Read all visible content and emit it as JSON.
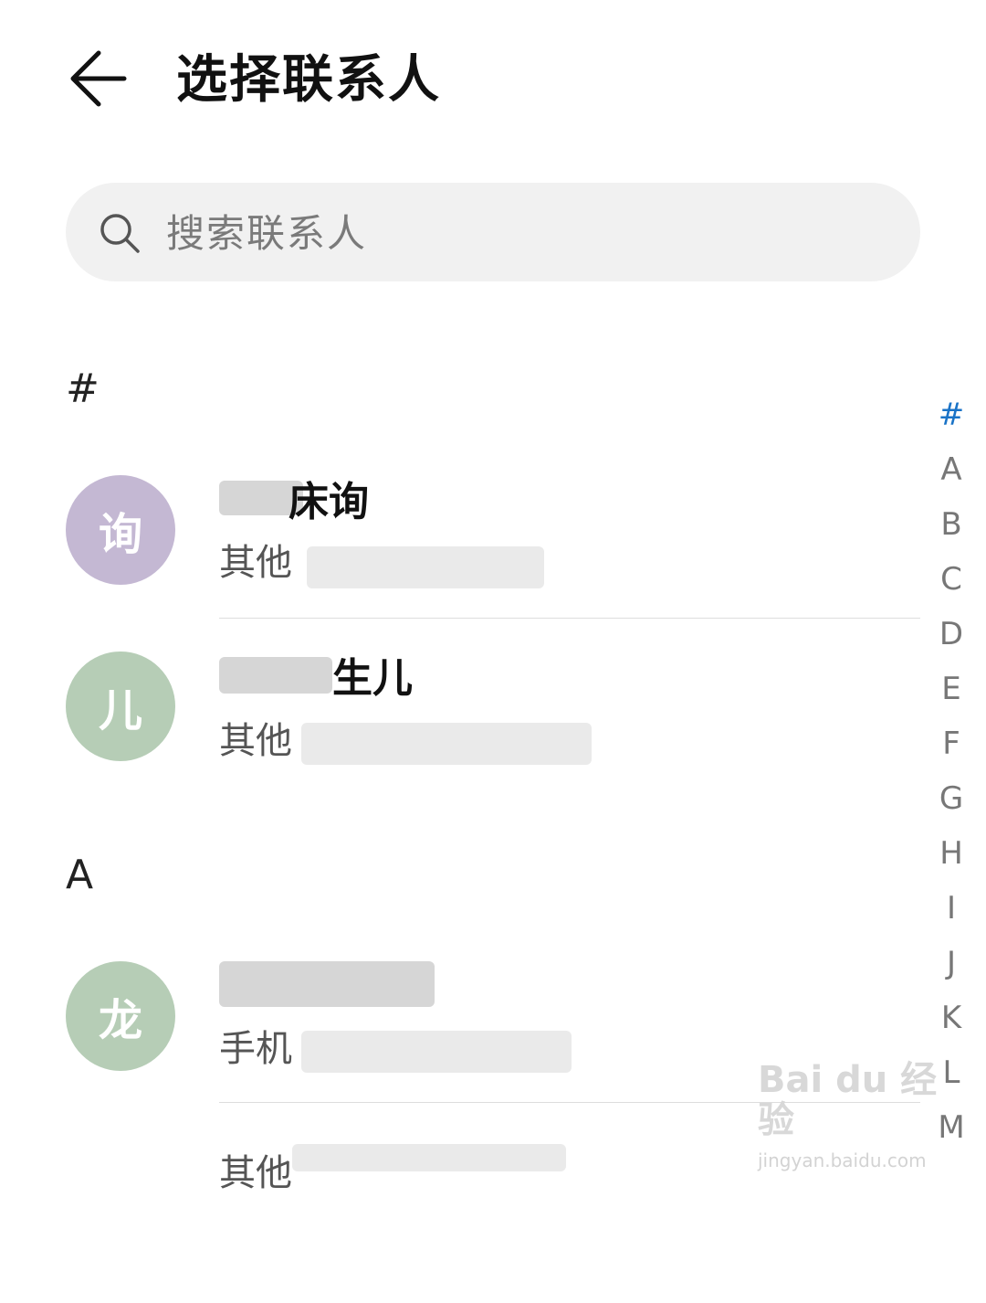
{
  "header": {
    "title": "选择联系人"
  },
  "search": {
    "placeholder": "搜索联系人"
  },
  "sections": [
    {
      "letter": "#",
      "contacts": [
        {
          "avatar_char": "询",
          "avatar_color": "#c4b8d3",
          "name_visible": "床询",
          "label": "其他"
        },
        {
          "avatar_char": "儿",
          "avatar_color": "#b6cdb6",
          "name_visible": "生儿",
          "label": "其他"
        }
      ]
    },
    {
      "letter": "A",
      "contacts": [
        {
          "avatar_char": "龙",
          "avatar_color": "#b6cdb6",
          "name_visible": "",
          "label": "手机"
        },
        {
          "avatar_char": "",
          "avatar_color": "",
          "name_visible": "",
          "label": "其他"
        }
      ]
    }
  ],
  "index_bar": {
    "letters": [
      "#",
      "A",
      "B",
      "C",
      "D",
      "E",
      "F",
      "G",
      "H",
      "I",
      "J",
      "K",
      "L",
      "M"
    ],
    "active": "#",
    "active_color": "#1a73c7"
  },
  "watermark": {
    "brand": "Bai du 经验",
    "url": "jingyan.baidu.com"
  }
}
